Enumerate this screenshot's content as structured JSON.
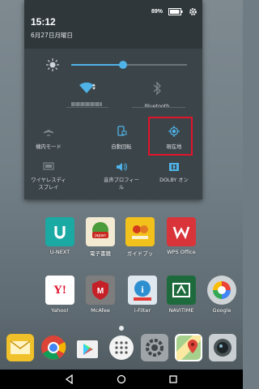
{
  "status": {
    "time": "15:12",
    "date": "6月27日月曜日",
    "battery": "89%"
  },
  "brightness": {
    "level": 0.45
  },
  "tiles": [
    {
      "id": "wifi",
      "label": "",
      "icon": "wifi-icon"
    },
    {
      "id": "bluetooth",
      "label": "Bluetooth",
      "icon": "bluetooth-icon"
    },
    {
      "id": "airplane",
      "label": "機内モード",
      "icon": "airplane-icon"
    },
    {
      "id": "autorotate",
      "label": "自動回転",
      "icon": "autorotate-icon"
    },
    {
      "id": "location",
      "label": "現在地",
      "icon": "location-icon"
    },
    {
      "id": "wireless-display",
      "label": "ワイヤレスディ\nスプレイ",
      "icon": "cast-icon"
    },
    {
      "id": "sound-profile",
      "label": "音声プロフィー\nル",
      "icon": "volume-icon"
    },
    {
      "id": "dolby",
      "label": "DOLBY オン",
      "icon": "dolby-icon"
    }
  ],
  "apps_row1": [
    {
      "label": "U-NEXT",
      "color": "#1aa9a3"
    },
    {
      "label": "電子書籍",
      "color": "#e8d8b0"
    },
    {
      "label": "ガイドブッ",
      "color": "#f2c11b"
    },
    {
      "label": "WPS Office",
      "color": "#d8343a"
    }
  ],
  "apps_row2": [
    {
      "label": "Yahoo!",
      "color": "#ffffff"
    },
    {
      "label": "McAfee",
      "color": "#7b7b7b"
    },
    {
      "label": "i-Filter",
      "color": "#2e8fd0"
    },
    {
      "label": "NAVITIME",
      "color": "#1d6b3c"
    },
    {
      "label": "Google",
      "color": "#cfd4d7"
    }
  ],
  "dock": [
    {
      "name": "email-icon",
      "color": "#f0c12a"
    },
    {
      "name": "chrome-icon",
      "color": "#ffffff"
    },
    {
      "name": "play-store-icon",
      "color": "#ffffff"
    },
    {
      "name": "app-drawer-icon",
      "color": "#f4f4f4"
    },
    {
      "name": "settings-icon",
      "color": "#9ea4a8"
    },
    {
      "name": "maps-icon",
      "color": "#ffffff"
    },
    {
      "name": "camera-icon",
      "color": "#c8ced2"
    }
  ]
}
